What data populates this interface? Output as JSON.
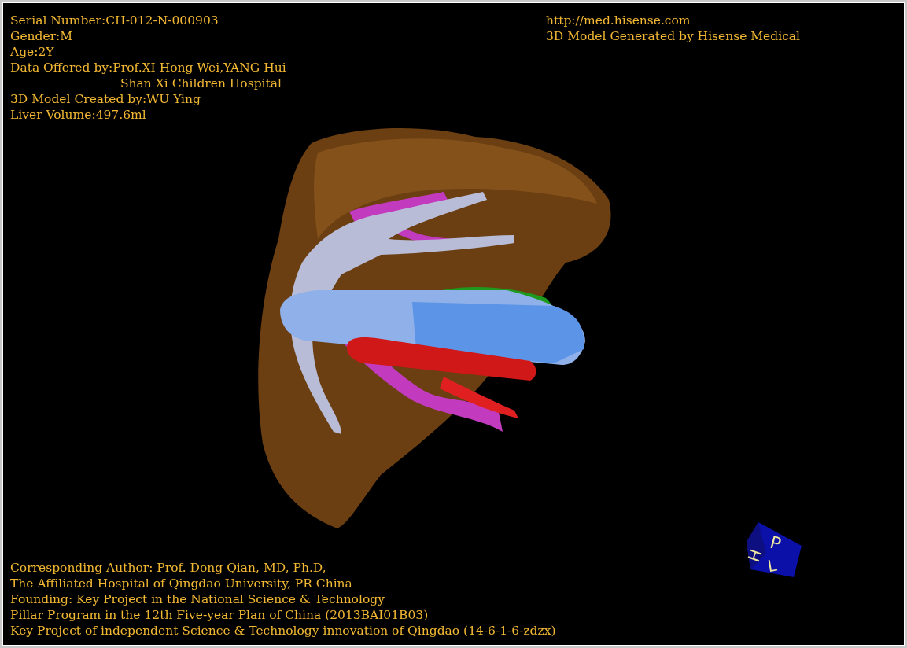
{
  "info_top_left": [
    {
      "kind": "line",
      "text": "Serial Number:CH-012-N-000903"
    },
    {
      "kind": "line",
      "text": "Gender:M"
    },
    {
      "kind": "line",
      "text": "Age:2Y"
    },
    {
      "kind": "line",
      "text": "Data Offered by:Prof.XI Hong Wei,YANG Hui"
    },
    {
      "kind": "continuation",
      "text": "Shan Xi Children Hospital"
    },
    {
      "kind": "line",
      "text": "3D Model Created by:WU Ying"
    },
    {
      "kind": "line",
      "text": "Liver Volume:497.6ml"
    }
  ],
  "info_top_right": [
    {
      "text": "http://med.hisense.com"
    },
    {
      "text": "3D Model Generated by Hisense Medical"
    }
  ],
  "info_bottom": [
    {
      "text": "Corresponding Author: Prof. Dong Qian, MD, Ph.D,"
    },
    {
      "text": "The Affiliated Hospital of Qingdao University, PR China"
    },
    {
      "text": "Founding: Key Project in the National Science & Technology"
    },
    {
      "text": "Pillar Program in the 12th Five-year Plan of China (2013BAI01B03)"
    },
    {
      "text": "Key Project of independent Science & Technology innovation of Qingdao (14-6-1-6-zdzx)"
    }
  ],
  "orientation_cube": {
    "faces": [
      "H",
      "P",
      "L"
    ]
  }
}
